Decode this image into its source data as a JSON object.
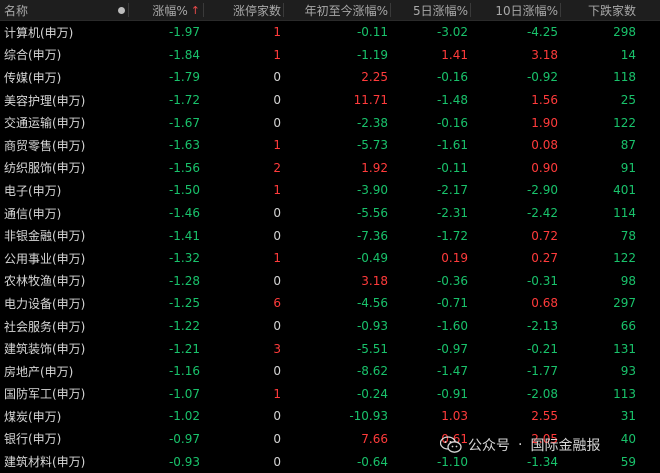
{
  "header": {
    "name": "名称",
    "chg": "涨幅%",
    "limit_up": "涨停家数",
    "ytd": "年初至今涨幅%",
    "d5": "5日涨幅%",
    "d10": "10日涨幅%",
    "down": "下跌家数",
    "sort_arrow": "↑"
  },
  "rows": [
    {
      "name": "计算机(申万)",
      "chg": "-1.97",
      "limit_up": "1",
      "ytd": "-0.11",
      "d5": "-3.02",
      "d10": "-4.25",
      "down": "298"
    },
    {
      "name": "综合(申万)",
      "chg": "-1.84",
      "limit_up": "1",
      "ytd": "-1.19",
      "d5": "1.41",
      "d10": "3.18",
      "down": "14"
    },
    {
      "name": "传媒(申万)",
      "chg": "-1.79",
      "limit_up": "0",
      "ytd": "2.25",
      "d5": "-0.16",
      "d10": "-0.92",
      "down": "118"
    },
    {
      "name": "美容护理(申万)",
      "chg": "-1.72",
      "limit_up": "0",
      "ytd": "11.71",
      "d5": "-1.48",
      "d10": "1.56",
      "down": "25"
    },
    {
      "name": "交通运输(申万)",
      "chg": "-1.67",
      "limit_up": "0",
      "ytd": "-2.38",
      "d5": "-0.16",
      "d10": "1.90",
      "down": "122"
    },
    {
      "name": "商贸零售(申万)",
      "chg": "-1.63",
      "limit_up": "1",
      "ytd": "-5.73",
      "d5": "-1.61",
      "d10": "0.08",
      "down": "87"
    },
    {
      "name": "纺织服饰(申万)",
      "chg": "-1.56",
      "limit_up": "2",
      "ytd": "1.92",
      "d5": "-0.11",
      "d10": "0.90",
      "down": "91"
    },
    {
      "name": "电子(申万)",
      "chg": "-1.50",
      "limit_up": "1",
      "ytd": "-3.90",
      "d5": "-2.17",
      "d10": "-2.90",
      "down": "401"
    },
    {
      "name": "通信(申万)",
      "chg": "-1.46",
      "limit_up": "0",
      "ytd": "-5.56",
      "d5": "-2.31",
      "d10": "-2.42",
      "down": "114"
    },
    {
      "name": "非银金融(申万)",
      "chg": "-1.41",
      "limit_up": "0",
      "ytd": "-7.36",
      "d5": "-1.72",
      "d10": "0.72",
      "down": "78"
    },
    {
      "name": "公用事业(申万)",
      "chg": "-1.32",
      "limit_up": "1",
      "ytd": "-0.49",
      "d5": "0.19",
      "d10": "0.27",
      "down": "122"
    },
    {
      "name": "农林牧渔(申万)",
      "chg": "-1.28",
      "limit_up": "0",
      "ytd": "3.18",
      "d5": "-0.36",
      "d10": "-0.31",
      "down": "98"
    },
    {
      "name": "电力设备(申万)",
      "chg": "-1.25",
      "limit_up": "6",
      "ytd": "-4.56",
      "d5": "-0.71",
      "d10": "0.68",
      "down": "297"
    },
    {
      "name": "社会服务(申万)",
      "chg": "-1.22",
      "limit_up": "0",
      "ytd": "-0.93",
      "d5": "-1.60",
      "d10": "-2.13",
      "down": "66"
    },
    {
      "name": "建筑装饰(申万)",
      "chg": "-1.21",
      "limit_up": "3",
      "ytd": "-5.51",
      "d5": "-0.97",
      "d10": "-0.21",
      "down": "131"
    },
    {
      "name": "房地产(申万)",
      "chg": "-1.16",
      "limit_up": "0",
      "ytd": "-8.62",
      "d5": "-1.47",
      "d10": "-1.77",
      "down": "93"
    },
    {
      "name": "国防军工(申万)",
      "chg": "-1.07",
      "limit_up": "1",
      "ytd": "-0.24",
      "d5": "-0.91",
      "d10": "-2.08",
      "down": "113"
    },
    {
      "name": "煤炭(申万)",
      "chg": "-1.02",
      "limit_up": "0",
      "ytd": "-10.93",
      "d5": "1.03",
      "d10": "2.55",
      "down": "31"
    },
    {
      "name": "银行(申万)",
      "chg": "-0.97",
      "limit_up": "0",
      "ytd": "7.66",
      "d5": "0.61",
      "d10": "2.05",
      "down": "40"
    },
    {
      "name": "建筑材料(申万)",
      "chg": "-0.93",
      "limit_up": "0",
      "ytd": "-0.64",
      "d5": "-1.10",
      "d10": "-1.34",
      "down": "59"
    }
  ],
  "watermark": {
    "prefix": "公众号",
    "separator": "·",
    "name": "国际金融报"
  },
  "colors": {
    "up": "#ff3b3b",
    "down": "#19c26b",
    "flat": "#d4d4d4",
    "background": "#000000",
    "header_bg": "#1e1e1e"
  }
}
